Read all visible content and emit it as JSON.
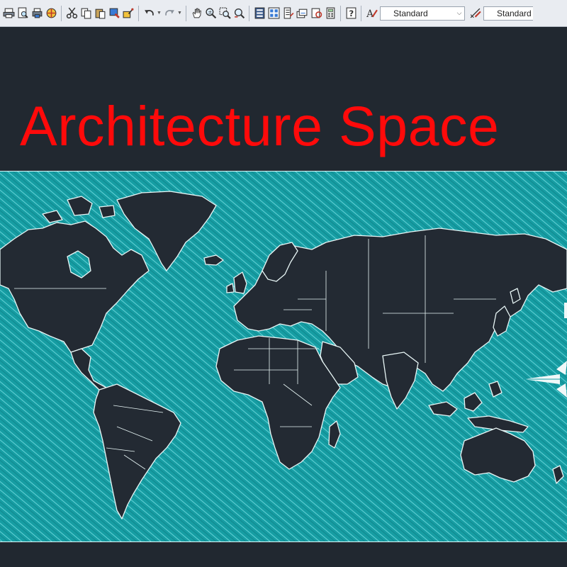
{
  "toolbar": {
    "text_style_value": "Standard",
    "dim_style_value": "Standard",
    "icons": [
      "print-icon",
      "print-preview-icon",
      "publish-icon",
      "3d-dwf-icon",
      "cut-icon",
      "copy-icon",
      "paste-icon",
      "match-properties-icon",
      "block-editor-icon",
      "undo-icon",
      "redo-icon",
      "pan-icon",
      "zoom-realtime-icon",
      "zoom-window-icon",
      "zoom-previous-icon",
      "properties-icon",
      "design-center-icon",
      "tool-palettes-icon",
      "sheet-set-icon",
      "markup-icon",
      "quickcalc-icon",
      "help-icon",
      "text-style-icon",
      "dim-style-icon"
    ]
  },
  "drawing": {
    "title": "Architecture Space",
    "title_color": "#ff0a0a",
    "background_color": "#212830",
    "ocean_color": "#169da3",
    "land_color": "#232a33",
    "outline_color": "#e8f6f6"
  }
}
